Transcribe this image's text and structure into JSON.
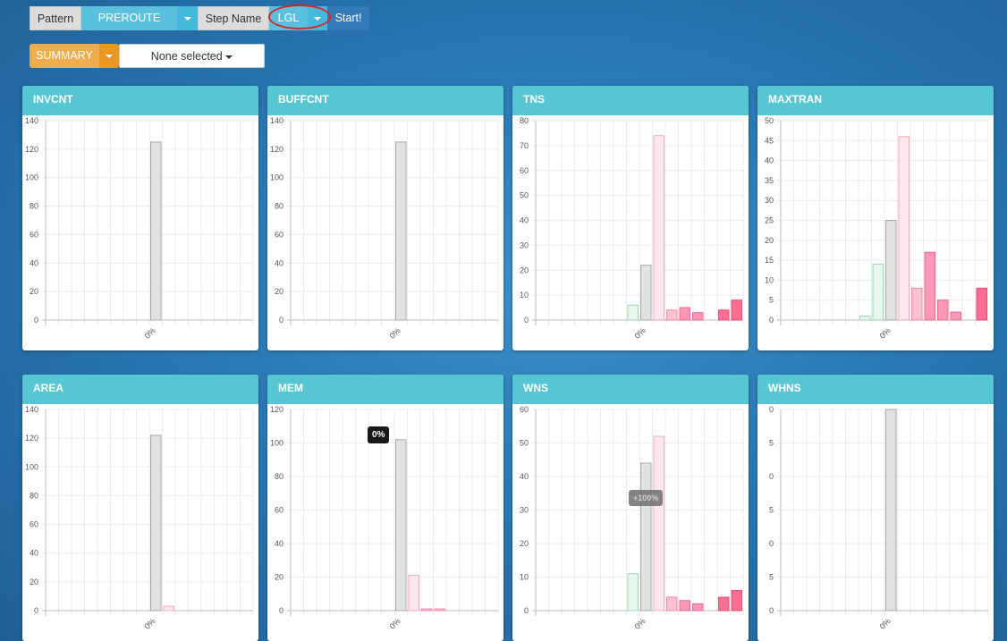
{
  "toolbar": {
    "pattern_label": "Pattern",
    "pattern_value": "PREROUTE",
    "step_label": "Step Name",
    "step_value": "LGL",
    "start_label": "Start!",
    "summary_label": "SUMMARY",
    "select_label": "None selected"
  },
  "colors": {
    "header": "#56c6d2",
    "bars": {
      "green": "#e8f8ee",
      "gray": "#e2e2e2",
      "pink_light": "#fde8ee",
      "pink_mid": "#ffc0d0",
      "pink_strong": "#ff98b6",
      "red": "#ff6f94"
    }
  },
  "tooltips": {
    "mem": "0%",
    "wns": "+100%"
  },
  "chart_data": [
    {
      "type": "bar",
      "title": "INVCNT",
      "ylim": [
        0,
        140
      ],
      "yticks": [
        0,
        20,
        40,
        60,
        80,
        100,
        120,
        140
      ],
      "xtick": "0%",
      "bars": [
        {
          "slot": 8,
          "value": 125,
          "color": "gray"
        }
      ]
    },
    {
      "type": "bar",
      "title": "BUFFCNT",
      "ylim": [
        0,
        140
      ],
      "yticks": [
        0,
        20,
        40,
        60,
        80,
        100,
        120,
        140
      ],
      "xtick": "0%",
      "bars": [
        {
          "slot": 8,
          "value": 125,
          "color": "gray"
        }
      ]
    },
    {
      "type": "bar",
      "title": "TNS",
      "ylim": [
        0,
        80
      ],
      "yticks": [
        0,
        10,
        20,
        30,
        40,
        50,
        60,
        70,
        80
      ],
      "xtick": "0%",
      "bars": [
        {
          "slot": 7,
          "value": 6,
          "color": "green"
        },
        {
          "slot": 8,
          "value": 22,
          "color": "gray"
        },
        {
          "slot": 9,
          "value": 74,
          "color": "pink_light"
        },
        {
          "slot": 10,
          "value": 4,
          "color": "pink_mid"
        },
        {
          "slot": 11,
          "value": 5,
          "color": "pink_strong"
        },
        {
          "slot": 12,
          "value": 3,
          "color": "pink_strong"
        },
        {
          "slot": 14,
          "value": 4,
          "color": "red"
        },
        {
          "slot": 15,
          "value": 8,
          "color": "red"
        }
      ]
    },
    {
      "type": "bar",
      "title": "MAXTRAN",
      "ylim": [
        0,
        50
      ],
      "yticks": [
        0,
        5,
        10,
        15,
        20,
        25,
        30,
        35,
        40,
        45,
        50
      ],
      "xtick": "0%",
      "bars": [
        {
          "slot": 6,
          "value": 1,
          "color": "green"
        },
        {
          "slot": 7,
          "value": 14,
          "color": "green"
        },
        {
          "slot": 8,
          "value": 25,
          "color": "gray"
        },
        {
          "slot": 9,
          "value": 46,
          "color": "pink_light"
        },
        {
          "slot": 10,
          "value": 8,
          "color": "pink_mid"
        },
        {
          "slot": 11,
          "value": 17,
          "color": "pink_strong"
        },
        {
          "slot": 12,
          "value": 5,
          "color": "pink_strong"
        },
        {
          "slot": 13,
          "value": 2,
          "color": "pink_strong"
        },
        {
          "slot": 15,
          "value": 8,
          "color": "red"
        }
      ]
    },
    {
      "type": "bar",
      "title": "AREA",
      "ylim": [
        0,
        140
      ],
      "yticks": [
        0,
        20,
        40,
        60,
        80,
        100,
        120,
        140
      ],
      "xtick": "0%",
      "bars": [
        {
          "slot": 8,
          "value": 122,
          "color": "gray"
        },
        {
          "slot": 9,
          "value": 3,
          "color": "pink_light"
        }
      ]
    },
    {
      "type": "bar",
      "title": "MEM",
      "ylim": [
        0,
        120
      ],
      "yticks": [
        0,
        20,
        40,
        60,
        80,
        100,
        120
      ],
      "xtick": "0%",
      "bars": [
        {
          "slot": 8,
          "value": 102,
          "color": "gray"
        },
        {
          "slot": 9,
          "value": 21,
          "color": "pink_light"
        },
        {
          "slot": 10,
          "value": 1,
          "color": "pink_mid"
        },
        {
          "slot": 11,
          "value": 1,
          "color": "pink_mid"
        }
      ]
    },
    {
      "type": "bar",
      "title": "WNS",
      "ylim": [
        0,
        60
      ],
      "yticks": [
        0,
        10,
        20,
        30,
        40,
        50,
        60
      ],
      "xtick": "0%",
      "bars": [
        {
          "slot": 7,
          "value": 11,
          "color": "green"
        },
        {
          "slot": 8,
          "value": 44,
          "color": "gray"
        },
        {
          "slot": 9,
          "value": 52,
          "color": "pink_light"
        },
        {
          "slot": 10,
          "value": 4,
          "color": "pink_mid"
        },
        {
          "slot": 11,
          "value": 3,
          "color": "pink_strong"
        },
        {
          "slot": 12,
          "value": 2,
          "color": "pink_strong"
        },
        {
          "slot": 14,
          "value": 4,
          "color": "red"
        },
        {
          "slot": 15,
          "value": 6,
          "color": "red"
        }
      ]
    },
    {
      "type": "bar",
      "title": "WHNS",
      "ylim": [
        0,
        60
      ],
      "yticks": [
        "0",
        "5",
        "0",
        "5",
        "0",
        "5",
        "0"
      ],
      "xtick": "0%",
      "bars": [
        {
          "slot": 8,
          "value": 60,
          "color": "gray"
        }
      ]
    }
  ]
}
